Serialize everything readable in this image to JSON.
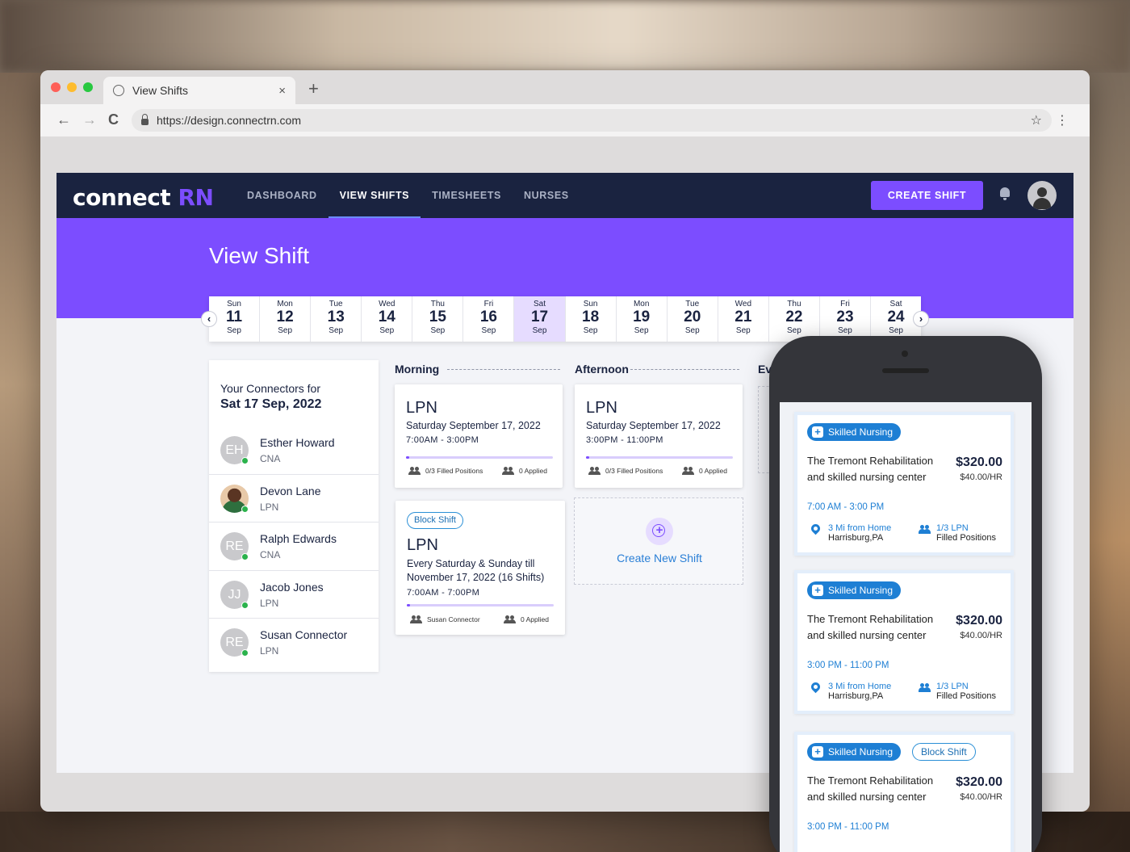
{
  "browser": {
    "tab_title": "View Shifts",
    "new_tab": "+",
    "tab_close": "×",
    "url": "https://design.connectrn.com",
    "back": "←",
    "forward": "→",
    "reload": "C",
    "bookmark": "☆",
    "menu": "⋮"
  },
  "app": {
    "logo_main": "connect",
    "logo_accent": "RN",
    "nav": [
      "DASHBOARD",
      "VIEW SHIFTS",
      "TIMESHEETS",
      "NURSES"
    ],
    "active_nav": "VIEW SHIFTS",
    "create_shift": "CREATE SHIFT",
    "page_title": "View Shift",
    "accent_color": "#7c4dff",
    "nav_bg": "#1a2340"
  },
  "calendar": {
    "prev": "‹",
    "next": "›",
    "selected_index": 6,
    "days": [
      {
        "dow": "Sun",
        "num": "11",
        "mon": "Sep"
      },
      {
        "dow": "Mon",
        "num": "12",
        "mon": "Sep"
      },
      {
        "dow": "Tue",
        "num": "13",
        "mon": "Sep"
      },
      {
        "dow": "Wed",
        "num": "14",
        "mon": "Sep"
      },
      {
        "dow": "Thu",
        "num": "15",
        "mon": "Sep"
      },
      {
        "dow": "Fri",
        "num": "16",
        "mon": "Sep"
      },
      {
        "dow": "Sat",
        "num": "17",
        "mon": "Sep"
      },
      {
        "dow": "Sun",
        "num": "18",
        "mon": "Sep"
      },
      {
        "dow": "Mon",
        "num": "19",
        "mon": "Sep"
      },
      {
        "dow": "Tue",
        "num": "20",
        "mon": "Sep"
      },
      {
        "dow": "Wed",
        "num": "21",
        "mon": "Sep"
      },
      {
        "dow": "Thu",
        "num": "22",
        "mon": "Sep"
      },
      {
        "dow": "Fri",
        "num": "23",
        "mon": "Sep"
      },
      {
        "dow": "Sat",
        "num": "24",
        "mon": "Sep"
      }
    ]
  },
  "connectors": {
    "heading": "Your Connectors for",
    "date": "Sat 17 Sep, 2022",
    "people": [
      {
        "initials": "EH",
        "name": "Esther Howard",
        "role": "CNA",
        "photo": false
      },
      {
        "initials": "",
        "name": "Devon Lane",
        "role": "LPN",
        "photo": true
      },
      {
        "initials": "RE",
        "name": "Ralph Edwards",
        "role": "CNA",
        "photo": false
      },
      {
        "initials": "JJ",
        "name": "Jacob Jones",
        "role": "LPN",
        "photo": false
      },
      {
        "initials": "RE",
        "name": "Susan Connector",
        "role": "LPN",
        "photo": false
      }
    ]
  },
  "periods": {
    "morning": "Morning",
    "afternoon": "Afternoon",
    "evening": "Ev"
  },
  "shifts": {
    "morning": {
      "role": "LPN",
      "date": "Saturday September 17, 2022",
      "time": "7:00AM - 3:00PM",
      "filled": "0/3 Filled Positions",
      "applied": "0 Applied",
      "progress": 0.02
    },
    "afternoon": {
      "role": "LPN",
      "date": "Saturday September 17, 2022",
      "time": "3:00PM - 11:00PM",
      "filled": "0/3 Filled Positions",
      "applied": "0 Applied",
      "progress": 0.02
    },
    "block": {
      "badge": "Block Shift",
      "role": "LPN",
      "date_line1": "Every Saturday & Sunday till",
      "date_line2": "November 17, 2022 (16 Shifts)",
      "time": "7:00AM - 7:00PM",
      "filled": "Susan Connector",
      "applied": "0 Applied",
      "progress": 0.02
    },
    "create_new": "Create New Shift"
  },
  "mobile": {
    "cards": [
      {
        "badge": "Skilled Nursing",
        "badge2": "",
        "name": "The Tremont Rehabilitation and skilled nursing center",
        "price": "$320.00",
        "rate": "$40.00/HR",
        "time": "7:00 AM - 3:00 PM",
        "distance": "3 Mi from Home",
        "city": "Harrisburg,PA",
        "positions": "1/3 LPN",
        "positions_label": "Filled Positions"
      },
      {
        "badge": "Skilled Nursing",
        "badge2": "",
        "name": "The Tremont Rehabilitation and skilled nursing center",
        "price": "$320.00",
        "rate": "$40.00/HR",
        "time": "3:00 PM - 11:00 PM",
        "distance": "3 Mi from Home",
        "city": "Harrisburg,PA",
        "positions": "1/3 LPN",
        "positions_label": "Filled Positions"
      },
      {
        "badge": "Skilled Nursing",
        "badge2": "Block Shift",
        "name": "The Tremont Rehabilitation and skilled nursing center",
        "price": "$320.00",
        "rate": "$40.00/HR",
        "time": "3:00 PM - 11:00 PM",
        "distance": "",
        "city": "",
        "positions": "",
        "positions_label": ""
      }
    ]
  }
}
